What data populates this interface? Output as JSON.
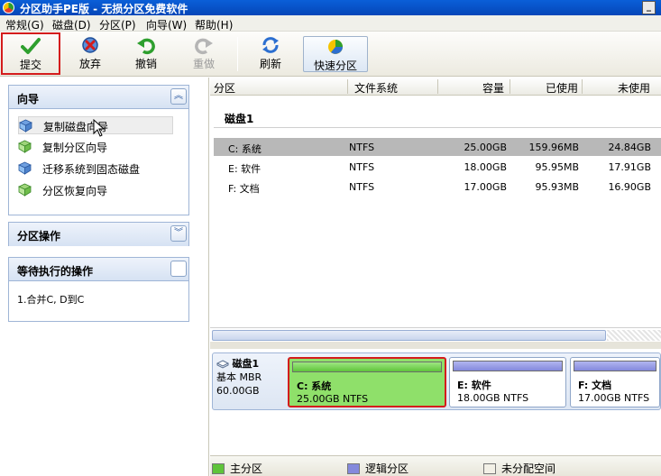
{
  "window": {
    "title": "分区助手PE版 - 无损分区免费软件",
    "min_label": "_",
    "max_label": "□"
  },
  "menu": [
    "常规(G)",
    "磁盘(D)",
    "分区(P)",
    "向导(W)",
    "帮助(H)"
  ],
  "toolbar": {
    "submit": "提交",
    "discard": "放弃",
    "undo": "撤销",
    "redo": "重做",
    "refresh": "刷新",
    "quick_partition": "快速分区"
  },
  "left": {
    "wizard_title": "向导",
    "wizard_items": [
      "复制磁盘向导",
      "复制分区向导",
      "迁移系统到固态磁盘",
      "分区恢复向导"
    ],
    "partition_ops_title": "分区操作",
    "pending_title": "等待执行的操作",
    "pending_items": [
      "1.合并C, D到C"
    ]
  },
  "table": {
    "headers": [
      "分区",
      "文件系统",
      "容量",
      "已使用",
      "未使用"
    ],
    "disk_label": "磁盘1",
    "rows": [
      {
        "partition": "C: 系统",
        "fs": "NTFS",
        "capacity": "25.00GB",
        "used": "159.96MB",
        "free": "24.84GB",
        "selected": true
      },
      {
        "partition": "E: 软件",
        "fs": "NTFS",
        "capacity": "18.00GB",
        "used": "95.95MB",
        "free": "17.91GB",
        "selected": false
      },
      {
        "partition": "F: 文档",
        "fs": "NTFS",
        "capacity": "17.00GB",
        "used": "95.93MB",
        "free": "16.90GB",
        "selected": false
      }
    ]
  },
  "disk_map": {
    "disk_name": "磁盘1",
    "disk_type": "基本 MBR",
    "disk_size": "60.00GB",
    "partitions": [
      {
        "name": "C: 系统",
        "info": "25.00GB NTFS"
      },
      {
        "name": "E: 软件",
        "info": "18.00GB NTFS"
      },
      {
        "name": "F: 文档",
        "info": "17.00GB NTFS"
      }
    ]
  },
  "legend": [
    "主分区",
    "逻辑分区",
    "未分配空间"
  ],
  "colors": {
    "primary": "#5fc43a",
    "logical": "#8489dc",
    "unallocated": "#f2f0e6",
    "highlight": "#d41c1c"
  }
}
